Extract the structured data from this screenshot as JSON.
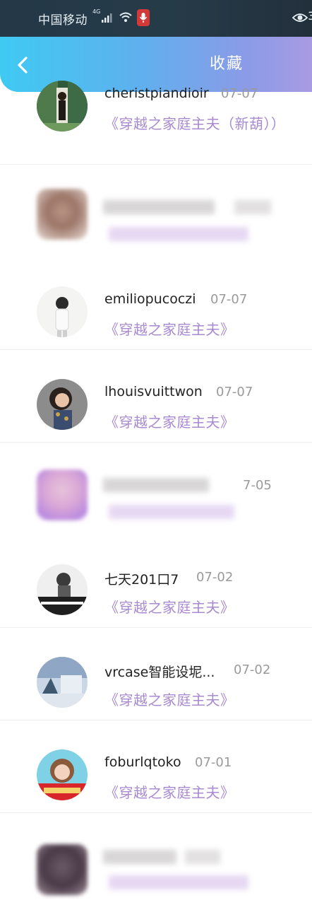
{
  "status_bar": {
    "carrier": "中国移动",
    "network_type": "4G",
    "clipped_text": "3"
  },
  "header": {
    "title": "收藏",
    "back_icon": "chevron-left-icon"
  },
  "colors": {
    "header_gradient_start": "#3fcaf2",
    "header_gradient_end": "#a89be3",
    "book_link": "#a88ad2",
    "date": "#9a9a9a"
  },
  "favorites": [
    {
      "name": "cheristpiandioir",
      "date": "07-07",
      "book": "《穿越之家庭主夫（新葫））",
      "blurred": false
    },
    {
      "name": "",
      "date": "",
      "book": "",
      "blurred": true
    },
    {
      "name": "emiliopucoczi",
      "date": "07-07",
      "book": "《穿越之家庭主夫》",
      "blurred": false
    },
    {
      "name": "lhouisvuittwon",
      "date": "07-07",
      "book": "《穿越之家庭主夫》",
      "blurred": false
    },
    {
      "name": "",
      "date": "7-05",
      "book": "",
      "blurred": true
    },
    {
      "name": "七天201口7",
      "date": "07-02",
      "book": "《穿越之家庭主夫》",
      "blurred": false
    },
    {
      "name": "vrcase智能设坭...",
      "date": "07-02",
      "book": "《穿越之家庭主夫》",
      "blurred": false
    },
    {
      "name": "foburlqtoko",
      "date": "07-01",
      "book": "《穿越之家庭主夫》",
      "blurred": false
    },
    {
      "name": "",
      "date": "",
      "book": "",
      "blurred": true
    }
  ]
}
